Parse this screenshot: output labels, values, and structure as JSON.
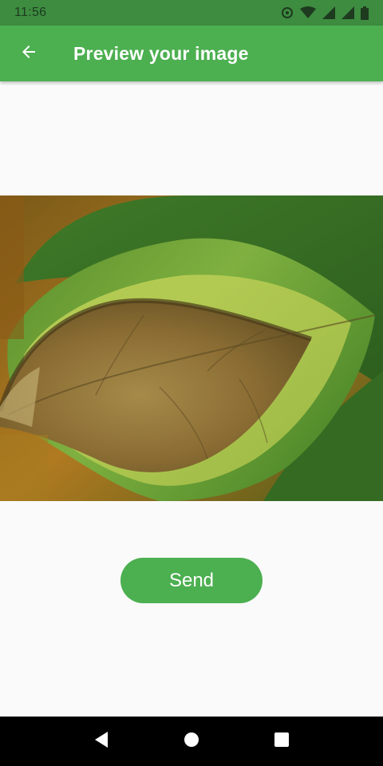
{
  "status_bar": {
    "time": "11:56",
    "icons": [
      "sync-icon",
      "wifi-icon",
      "signal-icon",
      "signal-icon",
      "battery-icon"
    ]
  },
  "app_bar": {
    "back_icon": "arrow-back-icon",
    "title": "Preview your image",
    "background": "#4caf50"
  },
  "preview": {
    "subject": "leaf-photo"
  },
  "actions": {
    "send_label": "Send"
  },
  "nav_bar": {
    "icons": [
      "back-triangle-icon",
      "home-circle-icon",
      "recents-square-icon"
    ]
  },
  "colors": {
    "accent": "#4caf50",
    "status_bar": "#3d8c40",
    "background": "#fafafa"
  }
}
